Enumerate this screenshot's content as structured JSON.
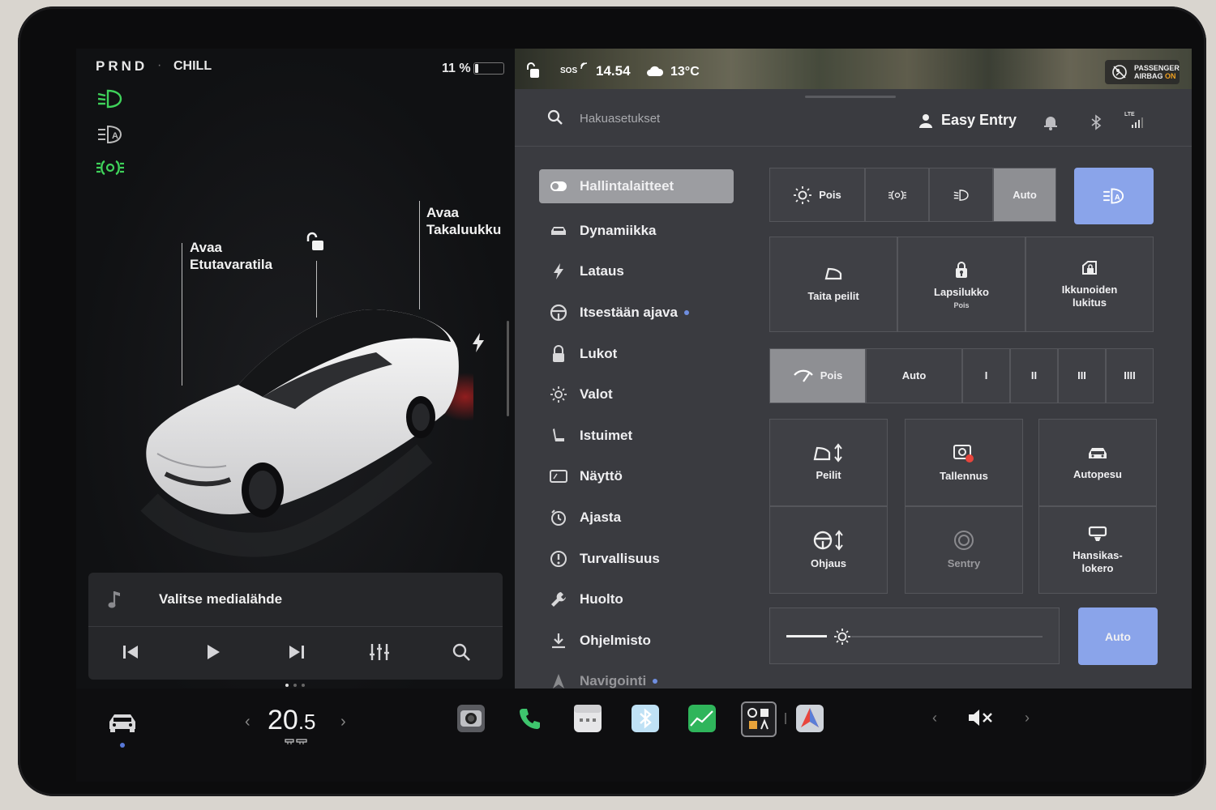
{
  "status": {
    "gears": "PRND",
    "separator": "·",
    "drive_mode": "CHILL",
    "battery_text": "11 %",
    "battery_level": 0.11
  },
  "car": {
    "frunk_label_1": "Avaa",
    "frunk_label_2": "Etutavaratila",
    "trunk_label_1": "Avaa",
    "trunk_label_2": "Takaluukku"
  },
  "media": {
    "source_label": "Valitse medialähde"
  },
  "topbar": {
    "sos": "SOS",
    "time": "14.54",
    "temperature": "13°C",
    "airbag_line1": "PASSENGER",
    "airbag_line2": "AIRBAG",
    "airbag_state": "ON"
  },
  "search": {
    "placeholder": "Hakuasetukset"
  },
  "profile": {
    "name": "Easy Entry",
    "lte": "LTE"
  },
  "menu": [
    {
      "label": "Hallintalaitteet",
      "icon": "toggle-icon",
      "active": true
    },
    {
      "label": "Dynamiikka",
      "icon": "car-icon"
    },
    {
      "label": "Lataus",
      "icon": "bolt-icon"
    },
    {
      "label": "Itsestään ajava",
      "icon": "steering-wheel-icon",
      "dot": true
    },
    {
      "label": "Lukot",
      "icon": "lock-icon"
    },
    {
      "label": "Valot",
      "icon": "light-icon"
    },
    {
      "label": "Istuimet",
      "icon": "seat-icon"
    },
    {
      "label": "Näyttö",
      "icon": "display-icon"
    },
    {
      "label": "Ajasta",
      "icon": "schedule-icon"
    },
    {
      "label": "Turvallisuus",
      "icon": "safety-icon"
    },
    {
      "label": "Huolto",
      "icon": "wrench-icon"
    },
    {
      "label": "Ohjelmisto",
      "icon": "download-icon"
    },
    {
      "label": "Navigointi",
      "icon": "navigation-icon",
      "dot": true
    }
  ],
  "controls": {
    "lights": {
      "off": "Pois",
      "auto": "Auto"
    },
    "fold_mirrors": "Taita peilit",
    "child_lock": "Lapsilukko",
    "child_lock_state": "Pois",
    "window_lock_1": "Ikkunoiden",
    "window_lock_2": "lukitus",
    "wipers": {
      "off": "Pois",
      "auto": "Auto",
      "speeds": [
        "I",
        "II",
        "III",
        "IIII"
      ]
    },
    "mirrors": "Peilit",
    "dashcam": "Tallennus",
    "car_wash": "Autopesu",
    "steering": "Ohjaus",
    "sentry": "Sentry",
    "glovebox_1": "Hansikas-",
    "glovebox_2": "lokero",
    "brightness_auto": "Auto",
    "brightness_level": 0.12
  },
  "climate": {
    "temp_whole": "20",
    "temp_decimal": ".5",
    "left_arrow": "‹",
    "right_arrow": "›"
  },
  "volume": {
    "left_arrow": "‹",
    "right_arrow": "›"
  },
  "colors": {
    "accent_blue": "#8aa4ea",
    "headlight_green": "#3fd25a",
    "menu_active": "#9c9da1"
  }
}
